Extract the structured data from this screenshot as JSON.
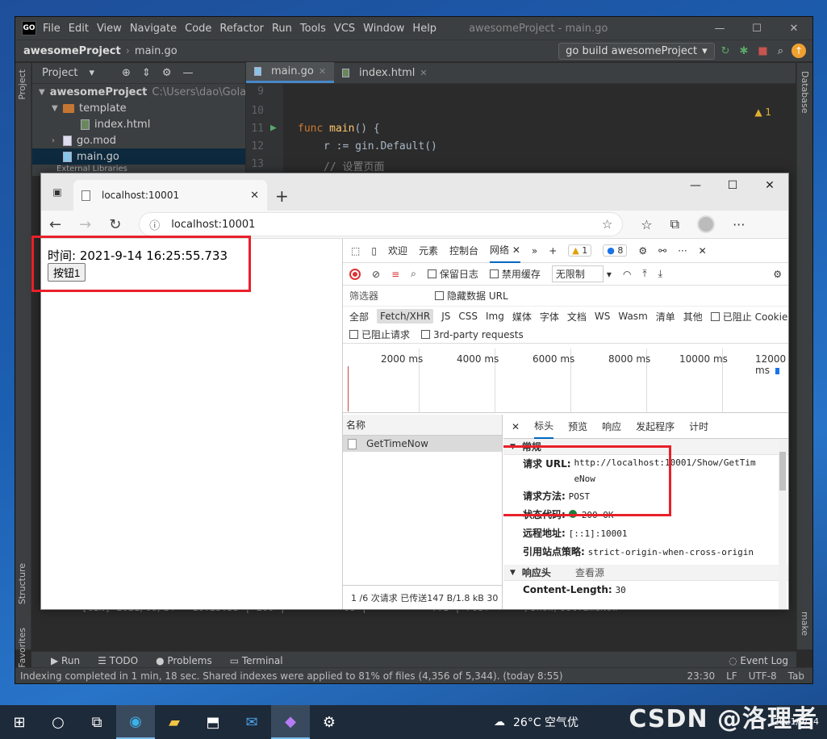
{
  "ide": {
    "logo": "GO",
    "menu": [
      "File",
      "Edit",
      "View",
      "Navigate",
      "Code",
      "Refactor",
      "Run",
      "Tools",
      "VCS",
      "Window",
      "Help"
    ],
    "window_title": "awesomeProject - main.go",
    "breadcrumb": [
      "awesomeProject",
      "main.go"
    ],
    "run_config": "go build awesomeProject",
    "project_panel": {
      "title": "Project",
      "root": "awesomeProject",
      "root_path": "C:\\Users\\dao\\Golan",
      "items": [
        {
          "label": "template",
          "type": "folder"
        },
        {
          "label": "index.html",
          "type": "file"
        },
        {
          "label": "go.mod",
          "type": "file"
        },
        {
          "label": "main.go",
          "type": "file"
        },
        {
          "label": "External Libraries",
          "type": "folder"
        }
      ]
    },
    "tabs": [
      {
        "label": "main.go",
        "active": true
      },
      {
        "label": "index.html",
        "active": false
      }
    ],
    "code": {
      "lines": [
        "9",
        "10",
        "11",
        "12",
        "13"
      ],
      "line11_kw": "func",
      "line11_fn": "main",
      "line11_rest": "() {",
      "line12": "r := gin.Default()",
      "line13": "// 设置页面"
    },
    "warning_count": "1",
    "left_tabs": [
      "Project",
      "Structure",
      "Favorites"
    ],
    "right_tabs": [
      "Database",
      "make"
    ],
    "log_line": "[GIN] 2021/09/14 - 16:25:55 | 200 |          0s |           ::1 | POST     \"/Show/GetTimeNow\"",
    "bottom_tabs": [
      "Run",
      "TODO",
      "Problems",
      "Terminal"
    ],
    "event_log": "Event Log",
    "status_msg": "Indexing completed in 1 min, 18 sec. Shared indexes were applied to 81% of files (4,356 of 5,344). (today 8:55)",
    "status_pos": "23:30",
    "status_lf": "LF",
    "status_enc": "UTF-8",
    "status_tab": "Tab"
  },
  "browser": {
    "tab_title": "localhost:10001",
    "url": "localhost:10001",
    "page": {
      "time_label": "时间: 2021-9-14 16:25:55.733",
      "button_label": "按钮1"
    }
  },
  "devtools": {
    "tabs": [
      "欢迎",
      "元素",
      "控制台",
      "网络"
    ],
    "warn_badge": "1",
    "msg_badge": "8",
    "toolbar": {
      "preserve_log": "保留日志",
      "disable_cache": "禁用缓存",
      "throttle": "无限制"
    },
    "filter_placeholder": "筛选器",
    "hide_data_url": "隐藏数据 URL",
    "types": [
      "全部",
      "Fetch/XHR",
      "JS",
      "CSS",
      "Img",
      "媒体",
      "字体",
      "文档",
      "WS",
      "Wasm",
      "清单",
      "其他"
    ],
    "blocked_cookies": "已阻止 Cookie",
    "blocked_requests": "已阻止请求",
    "third_party": "3rd-party requests",
    "timeline": [
      "2000 ms",
      "4000 ms",
      "6000 ms",
      "8000 ms",
      "10000 ms",
      "12000 ms"
    ],
    "list_header": "名称",
    "request_name": "GetTimeNow",
    "list_footer": "1 /6 次请求  已传送147 B/1.8 kB  30",
    "detail_tabs": [
      "标头",
      "预览",
      "响应",
      "发起程序",
      "计时"
    ],
    "general_title": "常规",
    "general": {
      "url_label": "请求 URL:",
      "url_value": "http://localhost:10001/Show/GetTimeNow",
      "method_label": "请求方法:",
      "method_value": "POST",
      "status_label": "状态代码:",
      "status_value": "200 OK",
      "remote_label": "远程地址:",
      "remote_value": "[::1]:10001",
      "referrer_label": "引用站点策略:",
      "referrer_value": "strict-origin-when-cross-origin"
    },
    "response_headers_title": "响应头",
    "view_source": "查看源",
    "content_length_label": "Content-Length:",
    "content_length_value": "30"
  },
  "taskbar": {
    "weather": "26°C  空气优",
    "date": "2021/9/14",
    "watermark": "CSDN @洛理者"
  }
}
